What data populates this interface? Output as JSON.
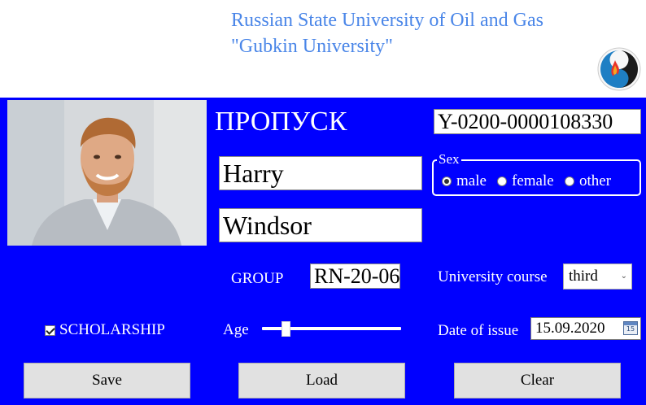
{
  "header": {
    "university_line1": "Russian State University of Oil and Gas",
    "university_line2": "\"Gubkin University\""
  },
  "card": {
    "title": "ПРОПУСК",
    "id_number": "Y-0200-0000108330",
    "first_name": "Harry",
    "last_name": "Windsor",
    "sex": {
      "legend": "Sex",
      "options": [
        "male",
        "female",
        "other"
      ],
      "selected": "male"
    },
    "group_label": "GROUP",
    "group_value": "RN-20-06",
    "course_label": "University course",
    "course_value": "third",
    "scholarship_label": "SCHOLARSHIP",
    "scholarship_checked": true,
    "age_label": "Age",
    "age_slider_fraction": 0.15,
    "issue_label": "Date of issue",
    "issue_date": "15.09.2020",
    "calendar_day": "15"
  },
  "buttons": {
    "save": "Save",
    "load": "Load",
    "clear": "Clear"
  },
  "colors": {
    "card_background": "#0000ff",
    "header_text": "#4a86e8",
    "label_text": "#ffffff"
  },
  "icons": [
    "university-logo-icon",
    "calendar-icon",
    "checkbox-checked-icon",
    "combo-chevron-icon"
  ]
}
